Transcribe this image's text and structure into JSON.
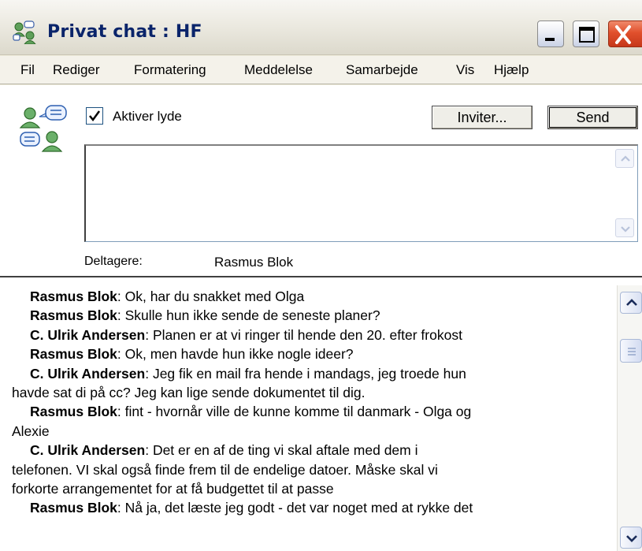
{
  "window": {
    "title": "Privat chat : HF"
  },
  "menu": [
    "Fil",
    "Rediger",
    "Formatering",
    "Meddelelse",
    "Samarbejde",
    "Vis",
    "Hjælp"
  ],
  "options": {
    "enable_sounds_label": "Aktiver lyde",
    "enable_sounds_checked": true
  },
  "buttons": {
    "invite": "Inviter...",
    "send": "Send"
  },
  "compose": {
    "value": ""
  },
  "participants": {
    "label": "Deltagere:",
    "value": "Rasmus Blok"
  },
  "transcript": [
    {
      "speaker": "Rasmus Blok",
      "sep": ": ",
      "text": "Ok, har du snakket med Olga"
    },
    {
      "speaker": "Rasmus Blok",
      "sep": ": ",
      "text": "Skulle hun ikke sende de seneste planer?"
    },
    {
      "speaker": "C. Ulrik Andersen",
      "sep": ": ",
      "text": "Planen er at vi ringer til hende den 20. efter frokost"
    },
    {
      "speaker": "Rasmus Blok",
      "sep": ": ",
      "text": "Ok, men havde hun ikke nogle ideer?"
    },
    {
      "speaker": "C. Ulrik Andersen",
      "sep": ": ",
      "text": "Jeg fik en mail fra hende i mandags, jeg troede hun"
    },
    {
      "speaker": "",
      "sep": "",
      "text": "havde sat di på cc? Jeg kan lige sende dokumentet til dig."
    },
    {
      "speaker": "Rasmus Blok",
      "sep": ": ",
      "text": "fint - hvornår ville de kunne komme til danmark - Olga og"
    },
    {
      "speaker": "",
      "sep": "",
      "text": "Alexie"
    },
    {
      "speaker": "C. Ulrik Andersen",
      "sep": ": ",
      "text": "Det er en af de ting vi skal aftale med dem i"
    },
    {
      "speaker": "",
      "sep": "",
      "text": "telefonen. VI skal også finde frem til de endelige datoer. Måske skal vi"
    },
    {
      "speaker": "",
      "sep": "",
      "text": "forkorte arrangementet for at få budgettet til at passe"
    },
    {
      "speaker": "Rasmus Blok",
      "sep": ": ",
      "text": "Nå ja, det læste jeg godt - det var noget med at rykke det"
    }
  ],
  "colors": {
    "title_text": "#0a246a",
    "close_button": "#e1502c",
    "window_bg": "#ece9d8"
  }
}
